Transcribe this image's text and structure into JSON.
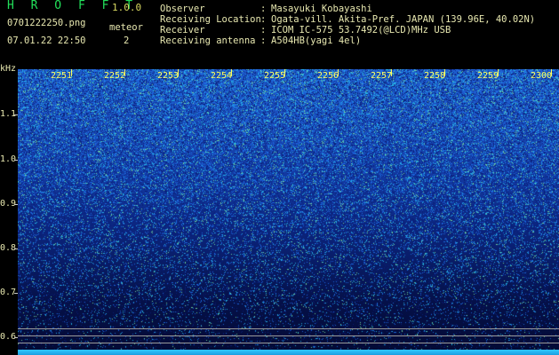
{
  "header": {
    "app_title": "H R O F F T",
    "version": "1.0.0",
    "file_name": "0701222250.png",
    "datetime": "07.01.22 22:50",
    "meteor_label": "meteor",
    "meteor_count": "2",
    "info": [
      {
        "key": "Observer",
        "value": "Masayuki Kobayashi"
      },
      {
        "key": "Receiving Location",
        "value": "Ogata-vill. Akita-Pref. JAPAN (139.96E, 40.02N)"
      },
      {
        "key": "Receiver",
        "value": "ICOM IC-575 53.7492(@LCD)MHz USB"
      },
      {
        "key": "Receiving antenna",
        "value": "A504HB(yagi 4el)"
      }
    ],
    "colon": ":"
  },
  "y_axis": {
    "unit": "kHz",
    "labels": [
      "1.1",
      "1.0",
      "0.9",
      "0.8",
      "0.7",
      "0.6"
    ]
  },
  "time_axis": {
    "labels": [
      "2251",
      "2252",
      "2253",
      "2254",
      "2255",
      "2256",
      "2257",
      "2258",
      "2259",
      "2300"
    ]
  },
  "colors": {
    "title": "#22e05a",
    "text": "#e8e8b0",
    "time_labels": "#ffff60",
    "spectrogram_top": "#1f5ac8",
    "spectrogram_bottom": "#030a34",
    "baseline": "#30c8ff"
  }
}
